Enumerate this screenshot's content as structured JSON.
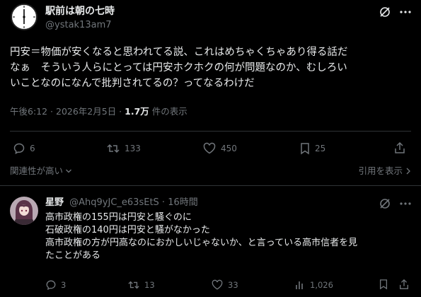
{
  "post": {
    "display_name": "駅前は朝の七時",
    "handle": "@ystak13am7",
    "text_lines": [
      "円安＝物価が安くなると思われてる説、これはめちゃくちゃあり得る話だ",
      "なぁ　そういう人らにとっては円安ホクホクの何が問題なのか、むしろい",
      "いことなのになんで批判されてるの？ってなるわけだ"
    ],
    "timestamp": "午後6:12 · 2026年2月5日 · ",
    "views_count": "1.7万",
    "views_suffix": " 件の表示",
    "stats": {
      "replies": "6",
      "reposts": "133",
      "likes": "450",
      "bookmarks": "25"
    }
  },
  "sort": {
    "label": "関連性が高い",
    "quote_label": "引用を表示"
  },
  "reply": {
    "display_name": "星野",
    "meta": "@Ahq9yJC_e63sEtS · 16時間",
    "text_lines": [
      "高市政権の155円は円安と騒ぐのに",
      "石破政権の140円は円安と騒がなかった",
      "高市政権の方が円高なのにおかしいじゃないか、と言っている高市信者を見",
      "たことがある"
    ],
    "stats": {
      "replies": "3",
      "reposts": "13",
      "likes": "33",
      "views": "1,026"
    }
  }
}
